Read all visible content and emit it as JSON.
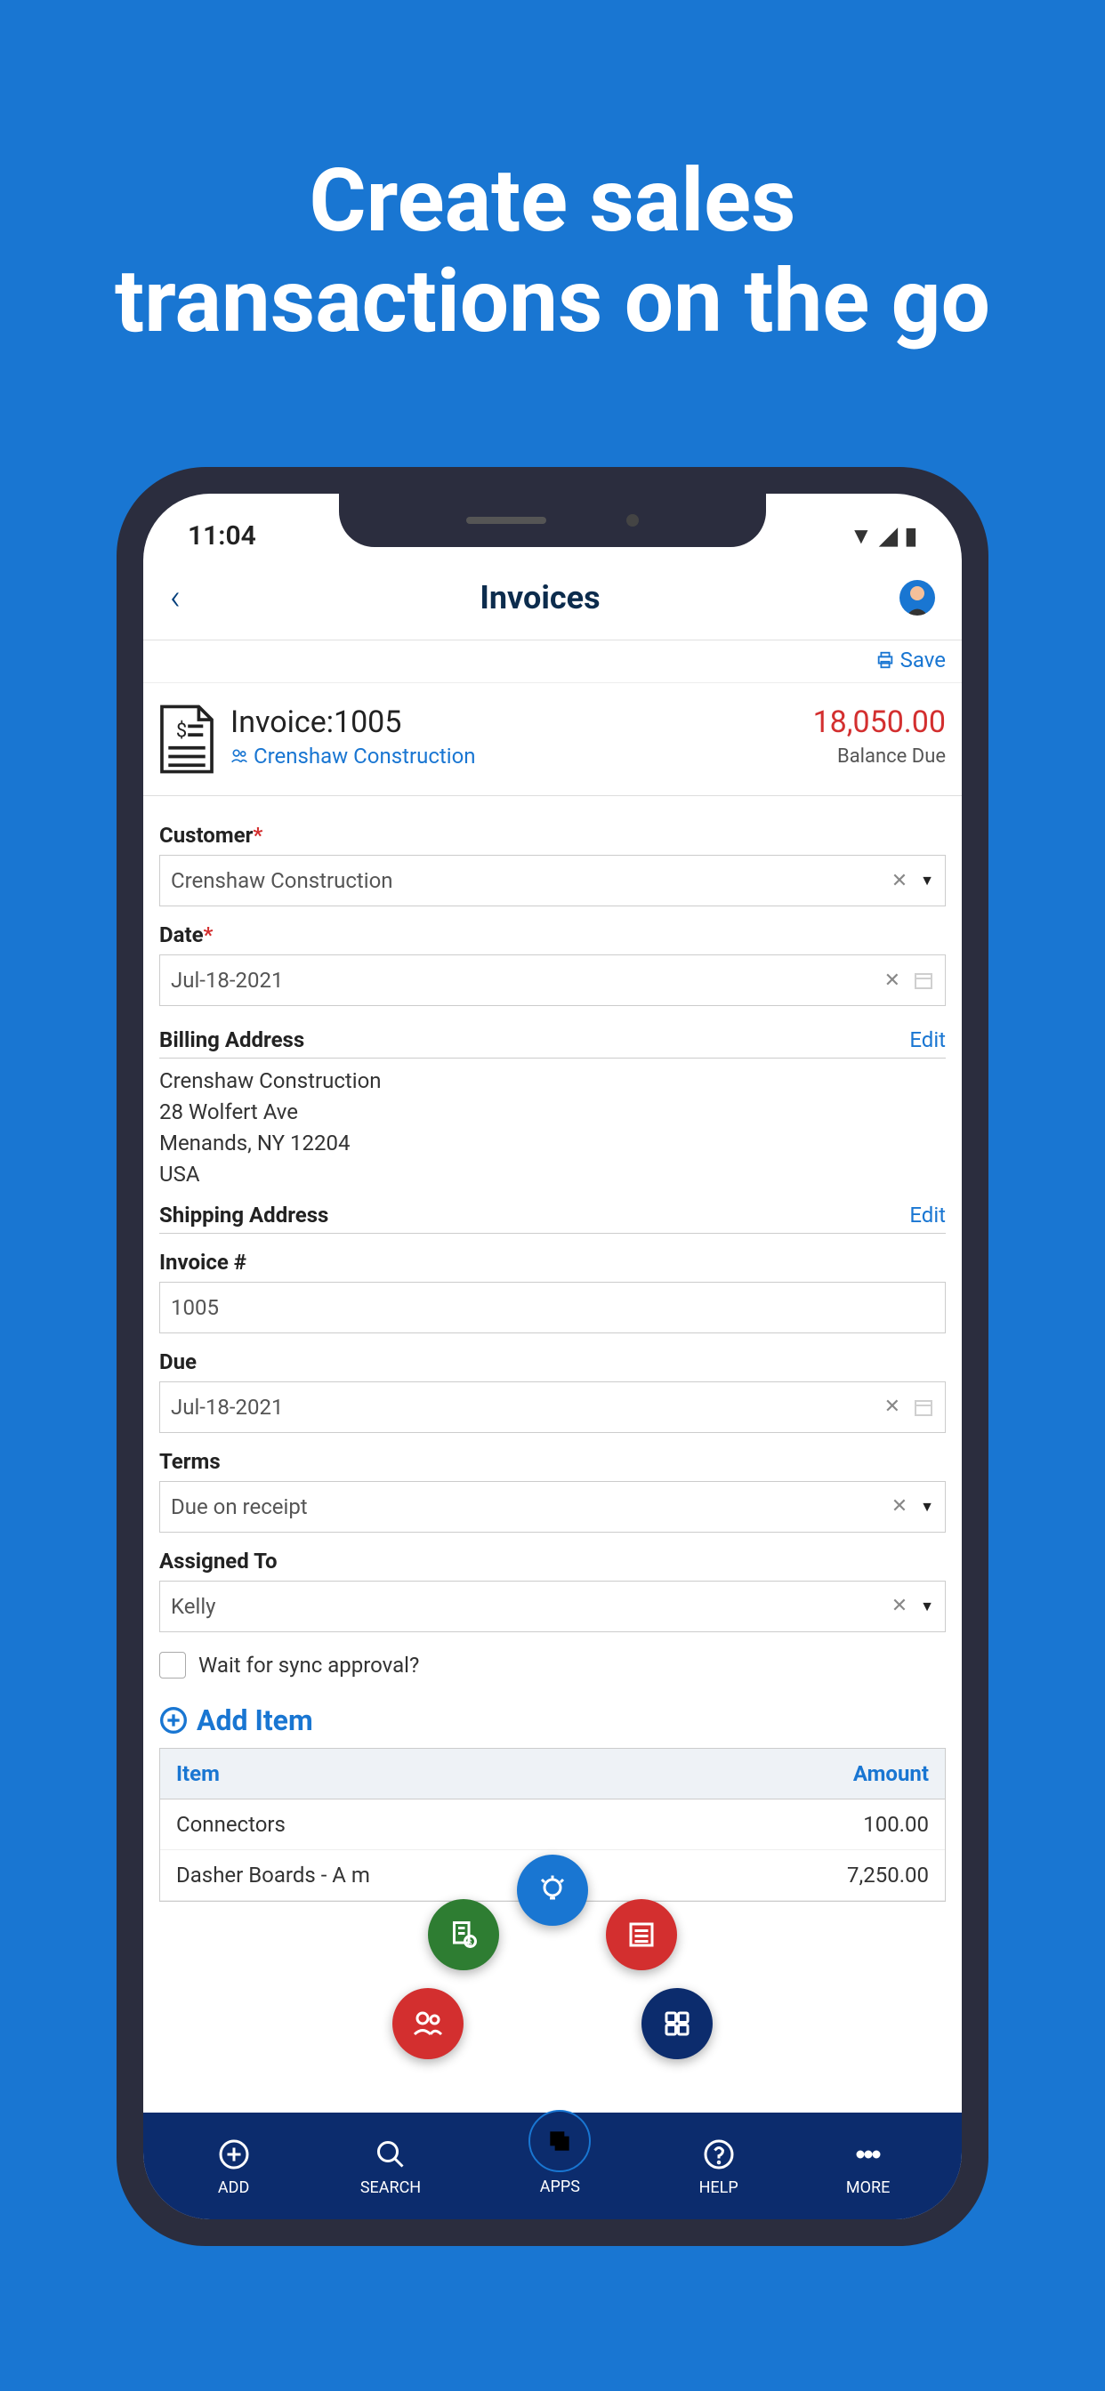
{
  "hero": {
    "line1": "Create sales",
    "line2": "transactions on the go"
  },
  "status": {
    "time": "11:04"
  },
  "header": {
    "title": "Invoices"
  },
  "actions": {
    "save": "Save"
  },
  "invoice": {
    "title": "Invoice:1005",
    "customer": "Crenshaw  Construction",
    "amount": "18,050.00",
    "balance_label": "Balance Due"
  },
  "form": {
    "customer_label": "Customer",
    "customer_value": "Crenshaw Construction",
    "date_label": "Date",
    "date_value": "Jul-18-2021",
    "billing_label": "Billing Address",
    "billing_edit": "Edit",
    "billing_addr_line1": "Crenshaw Construction",
    "billing_addr_line2": "28 Wolfert Ave",
    "billing_addr_line3": "Menands, NY 12204",
    "billing_addr_line4": "USA",
    "shipping_label": "Shipping Address",
    "shipping_edit": "Edit",
    "invoice_num_label": "Invoice #",
    "invoice_num_value": "1005",
    "due_label": "Due",
    "due_value": "Jul-18-2021",
    "terms_label": "Terms",
    "terms_value": "Due on receipt",
    "assigned_label": "Assigned To",
    "assigned_value": "Kelly",
    "sync_label": "Wait for sync approval?"
  },
  "items": {
    "add_label": "Add  Item",
    "header_item": "Item",
    "header_amount": "Amount",
    "rows": [
      {
        "name": "Connectors",
        "amount": "100.00"
      },
      {
        "name": "Dasher Boards - A          m",
        "amount": "7,250.00"
      }
    ]
  },
  "nav": {
    "add": "ADD",
    "search": "SEARCH",
    "apps": "APPS",
    "help": "HELP",
    "more": "MORE"
  }
}
